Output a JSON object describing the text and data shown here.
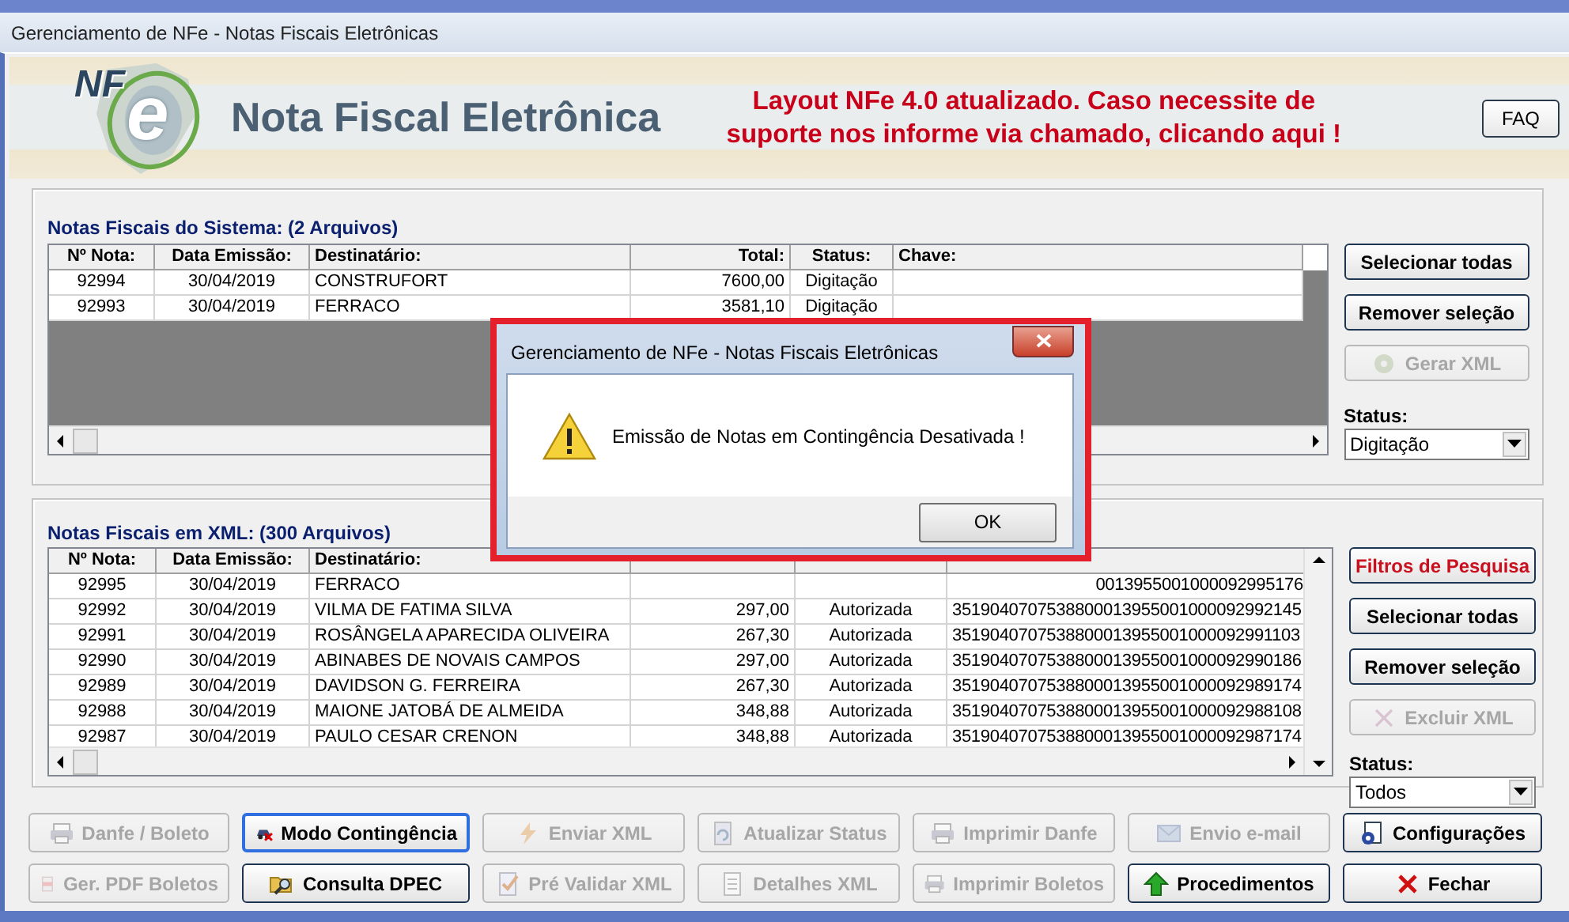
{
  "window": {
    "title": "Gerenciamento de NFe - Notas Fiscais Eletrônicas"
  },
  "banner": {
    "logo_letters": "NF",
    "logo_mark": "e",
    "title": "Nota Fiscal Eletrônica",
    "notice": "Layout NFe 4.0 atualizado. Caso necessite de suporte nos informe via chamado, clicando aqui !",
    "faq_button": "FAQ"
  },
  "panels": [
    {
      "title": "Notas Fiscais do Sistema: (2 Arquivos)",
      "columns": [
        "Nº Nota:",
        "Data Emissão:",
        "Destinatário:",
        "Total:",
        "Status:",
        "Chave:"
      ],
      "rows": [
        {
          "numero": "92994",
          "data": "30/04/2019",
          "destinatario": "CONSTRUFORT",
          "total": "7600,00",
          "status": "Digitação"
        },
        {
          "numero": "92993",
          "data": "30/04/2019",
          "destinatario": "FERRACO",
          "total": "3581,10",
          "status": "Digitação"
        }
      ],
      "buttons": [
        {
          "label": "Selecionar todas",
          "kind": "normal",
          "disabled": false
        },
        {
          "label": "Remover seleção",
          "kind": "normal",
          "disabled": false
        },
        {
          "label": "Gerar XML",
          "kind": "generate",
          "disabled": true
        }
      ],
      "status_label": "Status:",
      "status_value": "Digitação"
    },
    {
      "title": "Notas Fiscais em XML: (300 Arquivos)",
      "columns": [
        "Nº Nota:",
        "Data Emissão:",
        "Destinatário:"
      ],
      "rows": [
        {
          "numero": "92995",
          "data": "30/04/2019",
          "destinatario": "FERRACO",
          "chave": "0013955001000092995176"
        },
        {
          "numero": "92992",
          "data": "30/04/2019",
          "destinatario": "VILMA DE FATIMA SILVA",
          "total": "297,00",
          "status": "Autorizada",
          "chave": "3519040707538800013955001000092992145"
        },
        {
          "numero": "92991",
          "data": "30/04/2019",
          "destinatario": "ROSÂNGELA  APARECIDA OLIVEIRA",
          "total": "267,30",
          "status": "Autorizada",
          "chave": "3519040707538800013955001000092991103"
        },
        {
          "numero": "92990",
          "data": "30/04/2019",
          "destinatario": "ABINABES DE NOVAIS CAMPOS",
          "total": "297,00",
          "status": "Autorizada",
          "chave": "3519040707538800013955001000092990186"
        },
        {
          "numero": "92989",
          "data": "30/04/2019",
          "destinatario": "DAVIDSON G. FERREIRA",
          "total": "267,30",
          "status": "Autorizada",
          "chave": "3519040707538800013955001000092989174"
        },
        {
          "numero": "92988",
          "data": "30/04/2019",
          "destinatario": "MAIONE JATOBÁ DE ALMEIDA",
          "total": "348,88",
          "status": "Autorizada",
          "chave": "3519040707538800013955001000092988108"
        },
        {
          "numero": "92987",
          "data": "30/04/2019",
          "destinatario": "PAULO CESAR CRENON",
          "total": "348,88",
          "status": "Autorizada",
          "chave": "3519040707538800013955001000092987174"
        }
      ],
      "buttons": [
        {
          "label": "Filtros de Pesquisa",
          "kind": "filter",
          "disabled": false
        },
        {
          "label": "Selecionar todas",
          "kind": "normal",
          "disabled": false
        },
        {
          "label": "Remover seleção",
          "kind": "normal",
          "disabled": false
        },
        {
          "label": "Excluir XML",
          "kind": "delete",
          "disabled": true
        }
      ],
      "status_label": "Status:",
      "status_value": "Todos"
    }
  ],
  "actions": [
    {
      "label": "Danfe / Boleto",
      "disabled": true,
      "focused": false
    },
    {
      "label": "Modo Contingência",
      "disabled": false,
      "focused": true
    },
    {
      "label": "Enviar XML",
      "disabled": true,
      "focused": false
    },
    {
      "label": "Atualizar Status",
      "disabled": true,
      "focused": false
    },
    {
      "label": "Imprimir Danfe",
      "disabled": true,
      "focused": false
    },
    {
      "label": "Envio e-mail",
      "disabled": true,
      "focused": false
    },
    {
      "label": "Configurações",
      "disabled": false,
      "focused": false
    },
    {
      "label": "Ger. PDF Boletos",
      "disabled": true,
      "focused": false
    },
    {
      "label": "Consulta DPEC",
      "disabled": false,
      "focused": false
    },
    {
      "label": "Pré Validar XML",
      "disabled": true,
      "focused": false
    },
    {
      "label": "Detalhes XML",
      "disabled": true,
      "focused": false
    },
    {
      "label": "Imprimir Boletos",
      "disabled": true,
      "focused": false
    },
    {
      "label": "Procedimentos",
      "disabled": false,
      "focused": false
    },
    {
      "label": "Fechar",
      "disabled": false,
      "focused": false
    }
  ],
  "dialog": {
    "title": "Gerenciamento de NFe - Notas Fiscais Eletrônicas",
    "message": "Emissão de Notas em Contingência Desativada !",
    "ok_button": "OK"
  }
}
